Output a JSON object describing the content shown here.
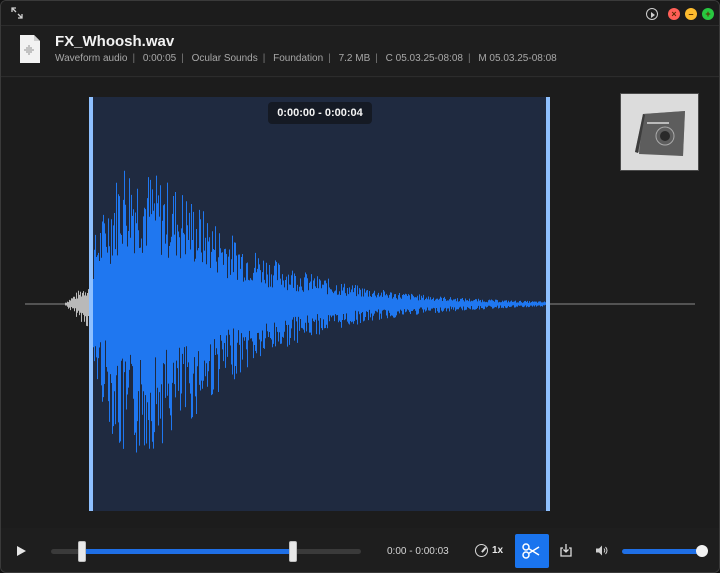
{
  "file": {
    "name": "FX_Whoosh.wav",
    "meta": {
      "type": "Waveform audio",
      "duration": "0:00:05",
      "author": "Ocular Sounds",
      "album": "Foundation",
      "size": "7.2 MB",
      "created": "C 05.03.25-08:08",
      "modified": "M 05.03.25-08:08"
    }
  },
  "selection": {
    "label": "0:00:00 - 0:00:04"
  },
  "controls": {
    "range_text": "0:00 - 0:00:03",
    "speed_label": "1x",
    "trim_start": 0.1,
    "trim_end": 0.78,
    "volume": 1.0
  },
  "icons": {
    "expand": "expand-icon",
    "play": "play-icon",
    "speed": "speedometer-icon",
    "trim": "scissors-icon",
    "export": "export-icon",
    "volume": "speaker-icon"
  },
  "colors": {
    "accent": "#1f6fe6",
    "waveform": "#1f77f0",
    "selection_bg": "#1f2a40",
    "close": "#ff5f57",
    "minimize": "#febc2e",
    "maximize": "#28c840"
  }
}
